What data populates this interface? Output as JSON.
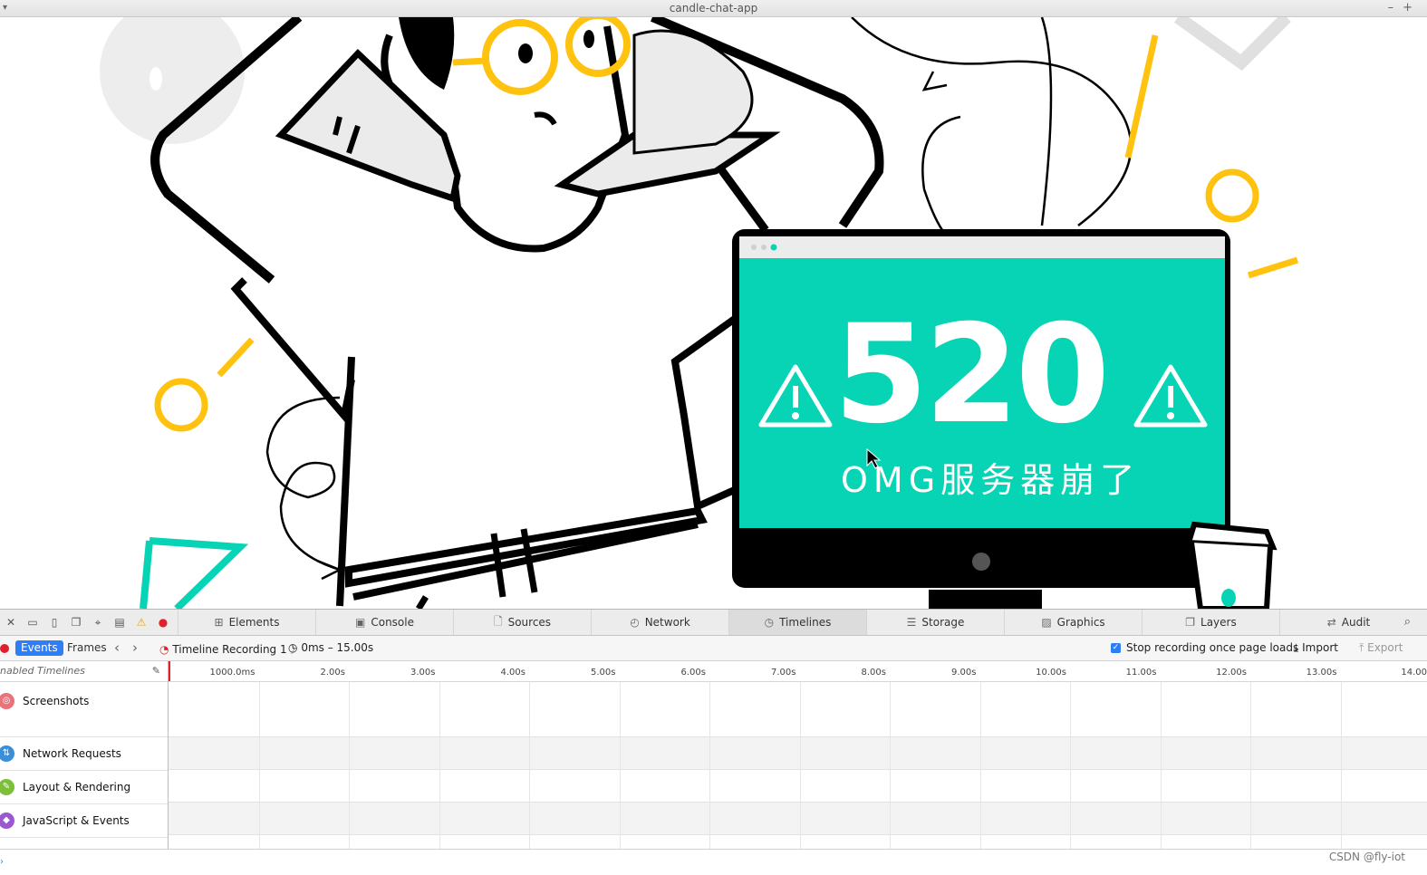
{
  "window": {
    "title": "candle-chat-app"
  },
  "illustration": {
    "error_code": "520",
    "error_message": "OMG服务器崩了",
    "colors": {
      "screen": "#07d4b5",
      "accent": "#ffc20e",
      "ink": "#000000"
    }
  },
  "devtools": {
    "tabs": [
      {
        "label": "Elements",
        "icon": "elements-icon",
        "glyph": "⊞"
      },
      {
        "label": "Console",
        "icon": "console-icon",
        "glyph": "▣"
      },
      {
        "label": "Sources",
        "icon": "sources-icon",
        "glyph": "🗋"
      },
      {
        "label": "Network",
        "icon": "network-icon",
        "glyph": "◴"
      },
      {
        "label": "Timelines",
        "icon": "timelines-icon",
        "glyph": "◷"
      },
      {
        "label": "Storage",
        "icon": "storage-icon",
        "glyph": "☰"
      },
      {
        "label": "Graphics",
        "icon": "graphics-icon",
        "glyph": "▨"
      },
      {
        "label": "Layers",
        "icon": "layers-icon",
        "glyph": "❐"
      },
      {
        "label": "Audit",
        "icon": "audit-icon",
        "glyph": "⇄"
      }
    ],
    "active_tab": "Timelines",
    "toolbar": {
      "events_label": "Events",
      "frames_label": "Frames",
      "recording_name": "Timeline Recording 1",
      "time_range": "0ms – 15.00s",
      "stop_recording_label": "Stop recording once page loads",
      "stop_recording_checked": true,
      "import_label": "Import",
      "export_label": "Export"
    },
    "sidebar": {
      "header": "nabled Timelines",
      "items": [
        {
          "label": "Screenshots",
          "icon": "screenshots-icon",
          "color": "#e8737a"
        },
        {
          "label": "Network Requests",
          "icon": "network-requests-icon",
          "color": "#3b8fd9"
        },
        {
          "label": "Layout & Rendering",
          "icon": "layout-rendering-icon",
          "color": "#7cbf3a"
        },
        {
          "label": "JavaScript & Events",
          "icon": "javascript-events-icon",
          "color": "#9b59d0"
        }
      ]
    },
    "ruler_ticks": [
      "1000.0ms",
      "2.00s",
      "3.00s",
      "4.00s",
      "5.00s",
      "6.00s",
      "7.00s",
      "8.00s",
      "9.00s",
      "10.00s",
      "11.00s",
      "12.00s",
      "13.00s",
      "14.00"
    ]
  },
  "watermark": "CSDN @fly-iot"
}
